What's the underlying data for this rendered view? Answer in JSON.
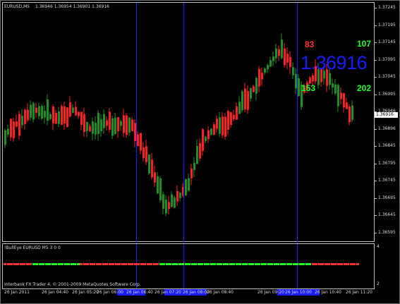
{
  "window": {
    "symbol_info": "EURUSD,M5",
    "ohlc": "1.36946 1.36954 1.36901 1.36916"
  },
  "price_axis": {
    "labels": [
      "1.37245",
      "1.37195",
      "1.37145",
      "1.37095",
      "1.37045",
      "1.36995",
      "1.36946",
      "1.36896",
      "1.36845",
      "1.36795",
      "1.36745",
      "1.36695",
      "1.36645",
      "1.36595"
    ],
    "current": "1.36916"
  },
  "overlay": {
    "big_price": "1.36916",
    "stat_top_left": "83",
    "stat_top_right": "107",
    "stat_bottom_left": "153",
    "stat_bottom_right": "202",
    "colors": {
      "red": "#ff3030",
      "green": "#22ff22",
      "blue": "#1a1aff"
    }
  },
  "indicator": {
    "title": "!BullEye EURUSD M5 3 0 0",
    "axis_top": "4",
    "axis_bottom": "2",
    "signal_sequence": "RRRRRRRRRGGGGGGGGGGGGGGGRRRRRRRRRRRRRRRRRRRRRRRRRGGGGGGGGGGGGGGGGGGGGGGGGGGGGGGGGGGGGGGGGGGGGGGGGRRRRRRRRRRRRRRR"
  },
  "footer": {
    "copyright": "Interbank FX Trader 4, © 2001-2009 MetaQuotes Software Corp."
  },
  "time_axis": [
    "26 Jan 2011",
    "26 Jan 04:40",
    "26 Jan 05:20",
    "26 Jan 06:00",
    "26 Jan 06:40",
    "26 Jan 07:20",
    "26 Jan 08:00",
    "26 Jan 08:40",
    "26 Jan 09:20",
    "26 Jan 10:00",
    "26 Jan 10:40",
    "26 Jan 11:20"
  ]
}
